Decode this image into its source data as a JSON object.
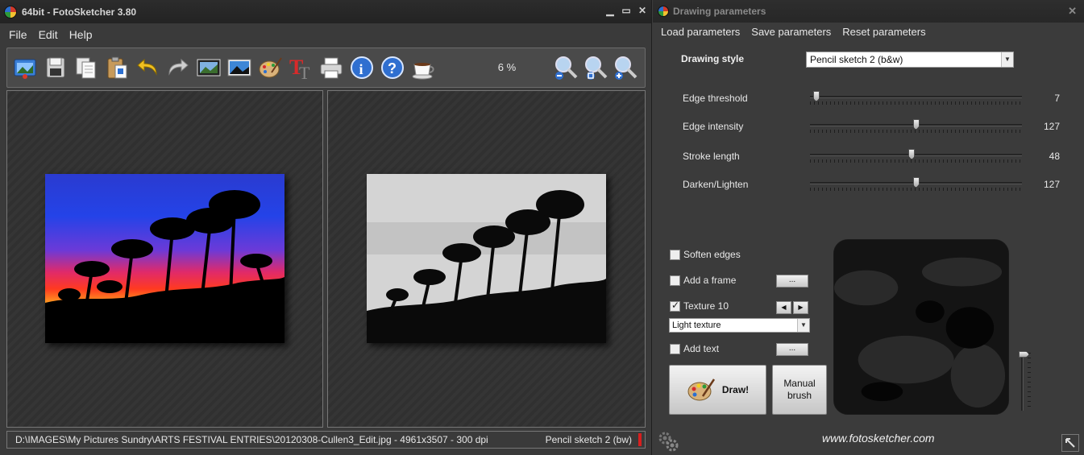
{
  "main_window": {
    "title": "64bit - FotoSketcher 3.80",
    "controls": {
      "minimize": "▁",
      "maximize": "▭",
      "close": "✕"
    }
  },
  "menu": {
    "file": "File",
    "edit": "Edit",
    "help": "Help"
  },
  "toolbar": {
    "buttons": [
      "open-image",
      "save",
      "copy",
      "paste",
      "undo",
      "redo",
      "image-settings",
      "landscape",
      "paint-palette",
      "add-text",
      "print",
      "info",
      "help",
      "coffee-donate"
    ],
    "zoom_value": "6 %",
    "zoom_buttons": [
      "zoom-out",
      "zoom-fit",
      "zoom-in"
    ]
  },
  "status": {
    "path": "D:\\IMAGES\\My Pictures Sundry\\ARTS FESTIVAL ENTRIES\\20120308-Cullen3_Edit.jpg - 4961x3507 - 300 dpi",
    "style": "Pencil sketch 2 (bw)"
  },
  "params": {
    "title": "Drawing parameters",
    "close": "✕",
    "menu": {
      "load": "Load parameters",
      "save": "Save parameters",
      "reset": "Reset parameters"
    },
    "style_label": "Drawing style",
    "style_value": "Pencil sketch 2 (b&w)",
    "sliders": [
      {
        "label": "Edge threshold",
        "value": "7",
        "fraction": 0.03
      },
      {
        "label": "Edge intensity",
        "value": "127",
        "fraction": 0.5
      },
      {
        "label": "Stroke length",
        "value": "48",
        "fraction": 0.48
      },
      {
        "label": "Darken/Lighten",
        "value": "127",
        "fraction": 0.5
      }
    ],
    "options": {
      "soften_edges": {
        "label": "Soften edges",
        "checked": false
      },
      "add_frame": {
        "label": "Add a frame",
        "checked": false,
        "button": "..."
      },
      "texture": {
        "label": "Texture 10",
        "checked": true,
        "prev": "◀",
        "next": "▶",
        "select_value": "Light texture"
      },
      "add_text": {
        "label": "Add text",
        "checked": false,
        "button": "..."
      }
    },
    "draw_label": "Draw!",
    "manual_brush_label": "Manual brush",
    "website": "www.fotosketcher.com"
  },
  "colors": {
    "accent_red": "#d81f1f",
    "bg": "#3a3a3a"
  }
}
